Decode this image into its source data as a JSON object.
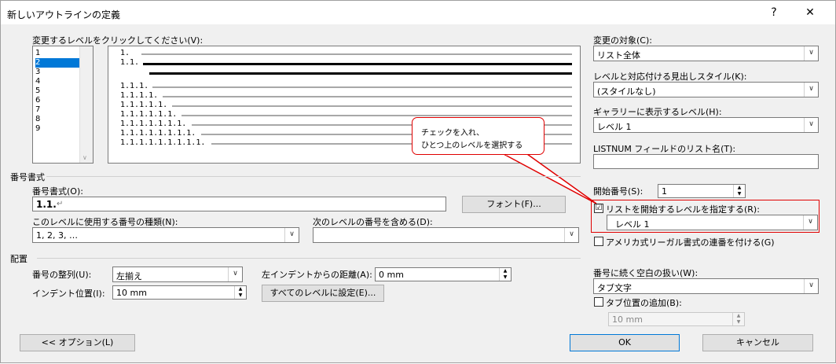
{
  "window": {
    "title": "新しいアウトラインの定義",
    "help_icon": "?",
    "close_icon": "✕"
  },
  "level_list": {
    "label": "変更するレベルをクリックしてください(V):",
    "items": [
      "1",
      "2",
      "3",
      "4",
      "5",
      "6",
      "7",
      "8",
      "9"
    ],
    "selected": "2"
  },
  "preview": {
    "rows": [
      "1.",
      "1.1.",
      "",
      "1.1.1.",
      "1.1.1.1.",
      "1.1.1.1.1.",
      "1.1.1.1.1.1.",
      "1.1.1.1.1.1.1.",
      "1.1.1.1.1.1.1.1.",
      "1.1.1.1.1.1.1.1.1."
    ]
  },
  "callout": {
    "line1": "チェックを入れ、",
    "line2": "ひとつ上のレベルを選択する"
  },
  "right_panel": {
    "apply_to_label": "変更の対象(C):",
    "apply_to_value": "リスト全体",
    "link_style_label": "レベルと対応付ける見出しスタイル(K):",
    "link_style_value": "(スタイルなし)",
    "gallery_level_label": "ギャラリーに表示するレベル(H):",
    "gallery_level_value": "レベル 1",
    "listnum_label": "LISTNUM フィールドのリスト名(T):",
    "listnum_value": "",
    "start_at_label": "開始番号(S):",
    "start_at_value": "1",
    "restart_label": "リストを開始するレベルを指定する(R):",
    "restart_checked": "☑",
    "restart_value": "レベル 1",
    "legal_label": "アメリカ式リーガル書式の連番を付ける(G)",
    "follow_label": "番号に続く空白の扱い(W):",
    "follow_value": "タブ文字",
    "tabstop_label": "タブ位置の追加(B):",
    "tabstop_value": "10 mm"
  },
  "number_format": {
    "section": "番号書式",
    "format_label": "番号書式(O):",
    "format_value": "1.1.",
    "font_button": "フォント(F)...",
    "style_label": "このレベルに使用する番号の種類(N):",
    "style_value": "1, 2, 3, …",
    "include_label": "次のレベルの番号を含める(D):",
    "include_value": ""
  },
  "position": {
    "section": "配置",
    "align_label": "番号の整列(U):",
    "align_value": "左揃え",
    "aligned_at_label": "左インデントからの距離(A):",
    "aligned_at_value": "0 mm",
    "indent_label": "インデント位置(I):",
    "indent_value": "10 mm",
    "set_all_button": "すべてのレベルに設定(E)..."
  },
  "footer": {
    "options_button": "<< オプション(L)",
    "ok_button": "OK",
    "cancel_button": "キャンセル"
  },
  "colors": {
    "selection": "#0078d7",
    "highlight": "#e00000"
  }
}
